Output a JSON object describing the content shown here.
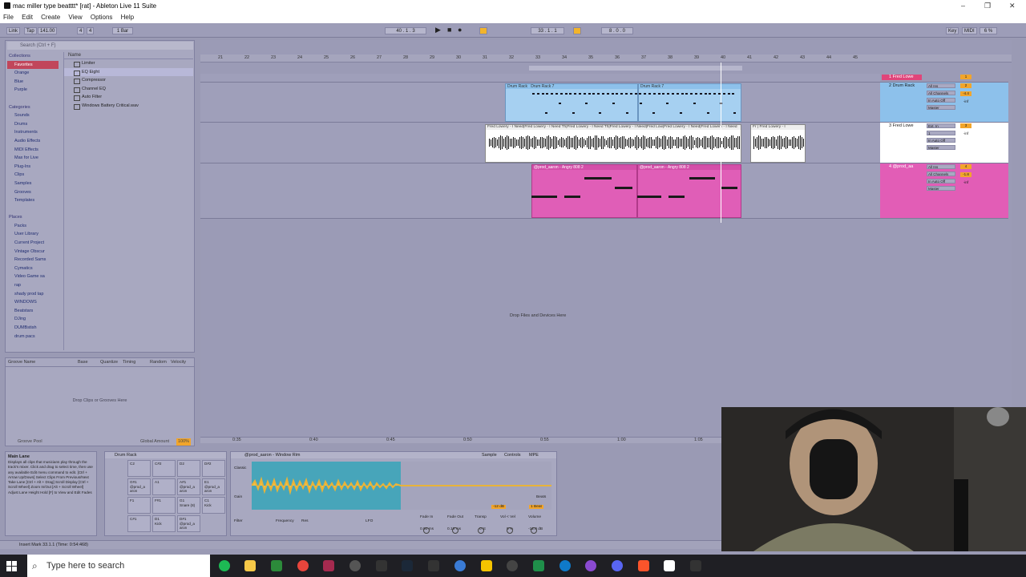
{
  "window": {
    "title": "mac miller type beatttt* [rat] - Ableton Live 11 Suite"
  },
  "menu": [
    "File",
    "Edit",
    "Create",
    "View",
    "Options",
    "Help"
  ],
  "toolbar": {
    "link": "Link",
    "tap": "Tap",
    "tempo": "141.00",
    "meter_num": "4",
    "meter_den": "4",
    "quantize": "1 Bar",
    "position": "40 . 1 . 3",
    "loop_start": "33 . 1 . 1",
    "loop_length": "8 . 0 . 0",
    "key": "Key",
    "midi": "MIDI",
    "cpu": "6 %"
  },
  "browser": {
    "search_placeholder": "Search (Ctrl + F)",
    "collections_header": "Collections",
    "collections": [
      "Favorites",
      "Orange",
      "Blue",
      "Purple"
    ],
    "categories_header": "Categories",
    "categories": [
      "Sounds",
      "Drums",
      "Instruments",
      "Audio Effects",
      "MIDI Effects",
      "Max for Live",
      "Plug-Ins",
      "Clips",
      "Samples",
      "Grooves",
      "Templates"
    ],
    "places_header": "Places",
    "places": [
      "Packs",
      "User Library",
      "Current Project",
      "Vintage Obscur",
      "Recorded Sams",
      "Cymatics",
      "Video Game sa",
      "rap",
      "shady prod tap",
      "WINDOWS",
      "Beatstars",
      "DJing",
      "DUMBstish",
      "drum pacs"
    ],
    "name_header": "Name",
    "items": [
      "Limiter",
      "EQ Eight",
      "Compressor",
      "Channel EQ",
      "Auto Filter",
      "Windows Battery Critical.wav"
    ]
  },
  "groove": {
    "headers": [
      "Groove Name",
      "Base",
      "Quantize",
      "Timing",
      "Random",
      "Velocity"
    ],
    "drop_text": "Drop Clips or Grooves Here",
    "pool_label": "Groove Pool",
    "global_amount_label": "Global Amount",
    "global_amount_value": "100%"
  },
  "ruler": [
    "21",
    "22",
    "23",
    "24",
    "25",
    "26",
    "27",
    "28",
    "29",
    "30",
    "31",
    "32",
    "33",
    "34",
    "35",
    "36",
    "37",
    "38",
    "39",
    "40",
    "41",
    "42",
    "43",
    "44",
    "45"
  ],
  "tracks": [
    {
      "name": "1 Fred Lowe",
      "color": "#e0457a",
      "routing": [],
      "num": "1"
    },
    {
      "name": "2 Drum Rack",
      "color": "#8dc1eb",
      "routing": [
        "All Ins",
        "All Channels",
        "In Auto Off",
        "Master"
      ],
      "num": "2",
      "vol": "-4.4",
      "sends": "-inf"
    },
    {
      "name": "3 Fred Lowe",
      "color": "#ffffff",
      "routing": [
        "Ext. In",
        "1",
        "In Auto Off",
        "Master"
      ],
      "num": "3",
      "sends": "-inf"
    },
    {
      "name": "4 @prod_aa",
      "color": "#e25db6",
      "routing": [
        "All Ins",
        "All Channels",
        "In Auto Off",
        "Master"
      ],
      "num": "4",
      "vol": "-1.8",
      "sends": "-inf"
    }
  ],
  "clips": {
    "drum1": "Drum Rack",
    "drum2": "Drum Rack 7",
    "drum3": "Drum Rack 7",
    "fred": [
      "Fred Lowery - I Need",
      "Fred Lowery - I Need Th",
      "Fred Lowery - I Need Th",
      "Fred Lowery - I Need",
      "Fred Low",
      "Fred Lowery - I Need",
      "Fred Lowery - I Need"
    ],
    "fred_extra": "Fr",
    "fred_extra2": "Fred Lowery - I",
    "bass1": "@prod_aaron - Angry 808 2",
    "bass2": "@prod_aaron - Angry 808 2"
  },
  "arrangement": {
    "drop_text": "Drop Files and Devices Here"
  },
  "timeline2": [
    "0:35",
    "0:40",
    "0:45",
    "0:50",
    "0:55",
    "1:00",
    "1:05"
  ],
  "info": {
    "title": "Main Lane",
    "text": "Displays all clips that musicians play through the track's mixer. Click and drag to select time, then use any available Edit menu command to edit. [Ctrl + Arrow Up/Down] Select Clips From Previous/Next Take Lane [Ctrl + Alt + Drag] Scroll Display [Ctrl + Scroll Wheel] Zoom In/Out [Alt + Scroll Wheel] Adjust Lane Height Hold [F] to View and Edit Fades"
  },
  "drum_rack": {
    "title": "Drum Rack",
    "pads": [
      {
        "note": "C2",
        "name": ""
      },
      {
        "note": "C#2",
        "name": ""
      },
      {
        "note": "D2",
        "name": ""
      },
      {
        "note": "D#2",
        "name": ""
      },
      {
        "note": "G#1",
        "name": "@prod_a aron"
      },
      {
        "note": "A1",
        "name": ""
      },
      {
        "note": "A#1",
        "name": "@prod_a aron"
      },
      {
        "note": "E1",
        "name": "@prod_a aron"
      },
      {
        "note": "F1",
        "name": ""
      },
      {
        "note": "F#1",
        "name": ""
      },
      {
        "note": "G1",
        "name": "Snare (8)"
      },
      {
        "note": "C1",
        "name": "Kick"
      },
      {
        "note": "C#1",
        "name": ""
      },
      {
        "note": "D1",
        "name": "Kick"
      },
      {
        "note": "D#1",
        "name": "@prod_a aron"
      }
    ]
  },
  "sampler": {
    "title": "@prod_aaron - Window Rim",
    "tabs": [
      "Sample",
      "Controls",
      "MPE"
    ],
    "mode": "Classic",
    "labels": [
      "Filter",
      "Frequency",
      "Res",
      "LFO",
      "Fade In",
      "Fade Out",
      "Transp",
      "Vol < Vel",
      "Volume",
      "Gain",
      "Beats"
    ],
    "values": {
      "fade_in": "0.00 ms",
      "fade_out": "0.10 ms",
      "transp": "0 st",
      "vel": "0 %",
      "volume": "-12.0 dB",
      "gain": "-12 dB",
      "beats": "1 Beat"
    }
  },
  "status": "Insert Mark 33.1.1 (Time: 0:54:468)",
  "taskbar": {
    "search_placeholder": "Type here to search"
  }
}
